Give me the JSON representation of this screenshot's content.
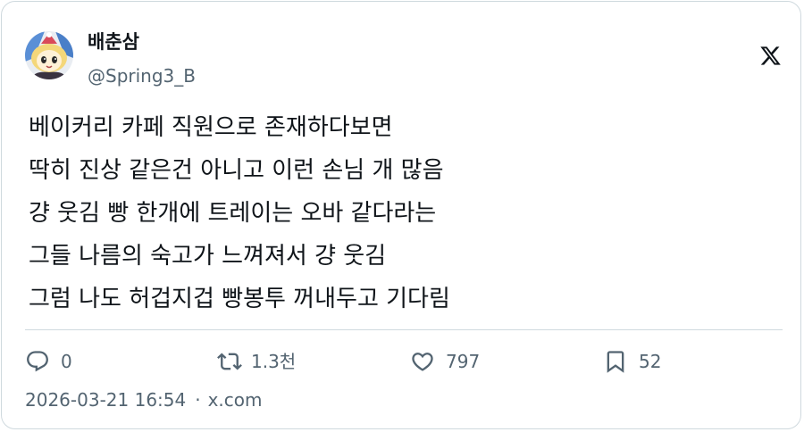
{
  "author": {
    "display_name": "배춘삼",
    "handle": "@Spring3_B",
    "avatar_icon": "anime-character-avatar"
  },
  "brand": {
    "logo_icon": "x-logo-icon"
  },
  "tweet": {
    "lines": [
      "베이커리 카페 직원으로 존재하다보면",
      "딱히 진상 같은건 아니고 이런 손님 개 많음",
      "걍 웃김 빵 한개에 트레이는 오바 같다라는",
      "그들 나름의 숙고가 느껴져서 걍 웃김",
      "그럼 나도 허겁지겁 빵봉투 꺼내두고 기다림"
    ]
  },
  "actions": {
    "replies": "0",
    "retweets": "1.3천",
    "likes": "797",
    "bookmarks": "52"
  },
  "meta": {
    "timestamp": "2026-03-21 16:54",
    "separator": "·",
    "site": "x.com"
  },
  "colors": {
    "text": "#0f1419",
    "secondary": "#536471",
    "border": "#cfd9de"
  }
}
